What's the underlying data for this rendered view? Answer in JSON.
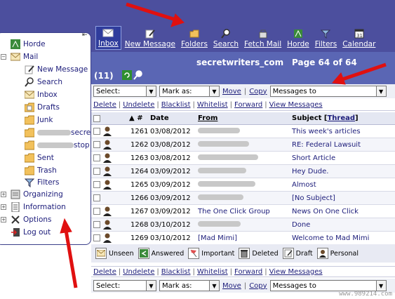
{
  "toolbar": {
    "items": [
      {
        "label": "Inbox",
        "icon": "envelope-icon",
        "active": true
      },
      {
        "label": "New Message",
        "icon": "compose-icon",
        "active": false
      },
      {
        "label": "Folders",
        "icon": "folder-icon",
        "active": false
      },
      {
        "label": "Search",
        "icon": "magnifier-icon",
        "active": false
      },
      {
        "label": "Fetch Mail",
        "icon": "fetch-icon",
        "active": false
      },
      {
        "label": "Horde",
        "icon": "horde-icon",
        "active": false
      },
      {
        "label": "Filters",
        "icon": "funnel-icon",
        "active": false
      },
      {
        "label": "Calendar",
        "icon": "calendar-icon",
        "active": false
      }
    ]
  },
  "header": {
    "mailbox_title": "secretwriters_com",
    "count": "(11)",
    "page": "Page 64 of 64"
  },
  "sidebar": {
    "horde": "Horde",
    "mail": "Mail",
    "new_message": "New Message",
    "search": "Search",
    "inbox": "Inbox",
    "drafts": "Drafts",
    "junk": "Junk",
    "partial1": "secre",
    "partial2": "stop",
    "sent": "Sent",
    "trash": "Trash",
    "filters": "Filters",
    "organizing": "Organizing",
    "information": "Information",
    "options": "Options",
    "logout": "Log out"
  },
  "actions": {
    "select": "Select:",
    "mark_as": "Mark as:",
    "move": "Move",
    "copy": "Copy",
    "messages_to": "Messages to",
    "delete": "Delete",
    "undelete": "Undelete",
    "blacklist": "Blacklist",
    "whitelist": "Whitelist",
    "forward": "Forward",
    "view_messages": "View Messages"
  },
  "table": {
    "col_num": "#",
    "col_date": "Date",
    "col_from": "From",
    "col_subject": "Subject",
    "col_thread": "Thread",
    "rows": [
      {
        "num": "1261",
        "date": "03/08/2012",
        "from": "",
        "subject": "This week's articles",
        "person": true
      },
      {
        "num": "1262",
        "date": "03/08/2012",
        "from": "",
        "subject": "RE: Federal Lawsuit",
        "person": true
      },
      {
        "num": "1263",
        "date": "03/08/2012",
        "from": "",
        "subject": "Short Article",
        "person": true
      },
      {
        "num": "1264",
        "date": "03/09/2012",
        "from": "",
        "subject": "Hey Dude.",
        "person": true
      },
      {
        "num": "1265",
        "date": "03/09/2012",
        "from": "",
        "subject": "Almost",
        "person": true
      },
      {
        "num": "1266",
        "date": "03/09/2012",
        "from": "",
        "subject": "[No Subject]",
        "person": false
      },
      {
        "num": "1267",
        "date": "03/09/2012",
        "from": "The One Click Group",
        "subject": "News On One Click",
        "person": true
      },
      {
        "num": "1268",
        "date": "03/10/2012",
        "from": "",
        "subject": "Done",
        "person": true
      },
      {
        "num": "1269",
        "date": "03/10/2012",
        "from": "[Mad Mimi]",
        "subject": "Welcome to Mad Mimi",
        "person": true
      }
    ]
  },
  "legend": {
    "unseen": "Unseen",
    "answered": "Answered",
    "important": "Important",
    "deleted": "Deleted",
    "draft": "Draft",
    "personal": "Personal"
  },
  "watermark": "www.989214.com",
  "colors": {
    "topbar": "#4c4f9e",
    "header": "#5a66b4",
    "link": "#1c1c7a",
    "arrow": "#e01010"
  }
}
